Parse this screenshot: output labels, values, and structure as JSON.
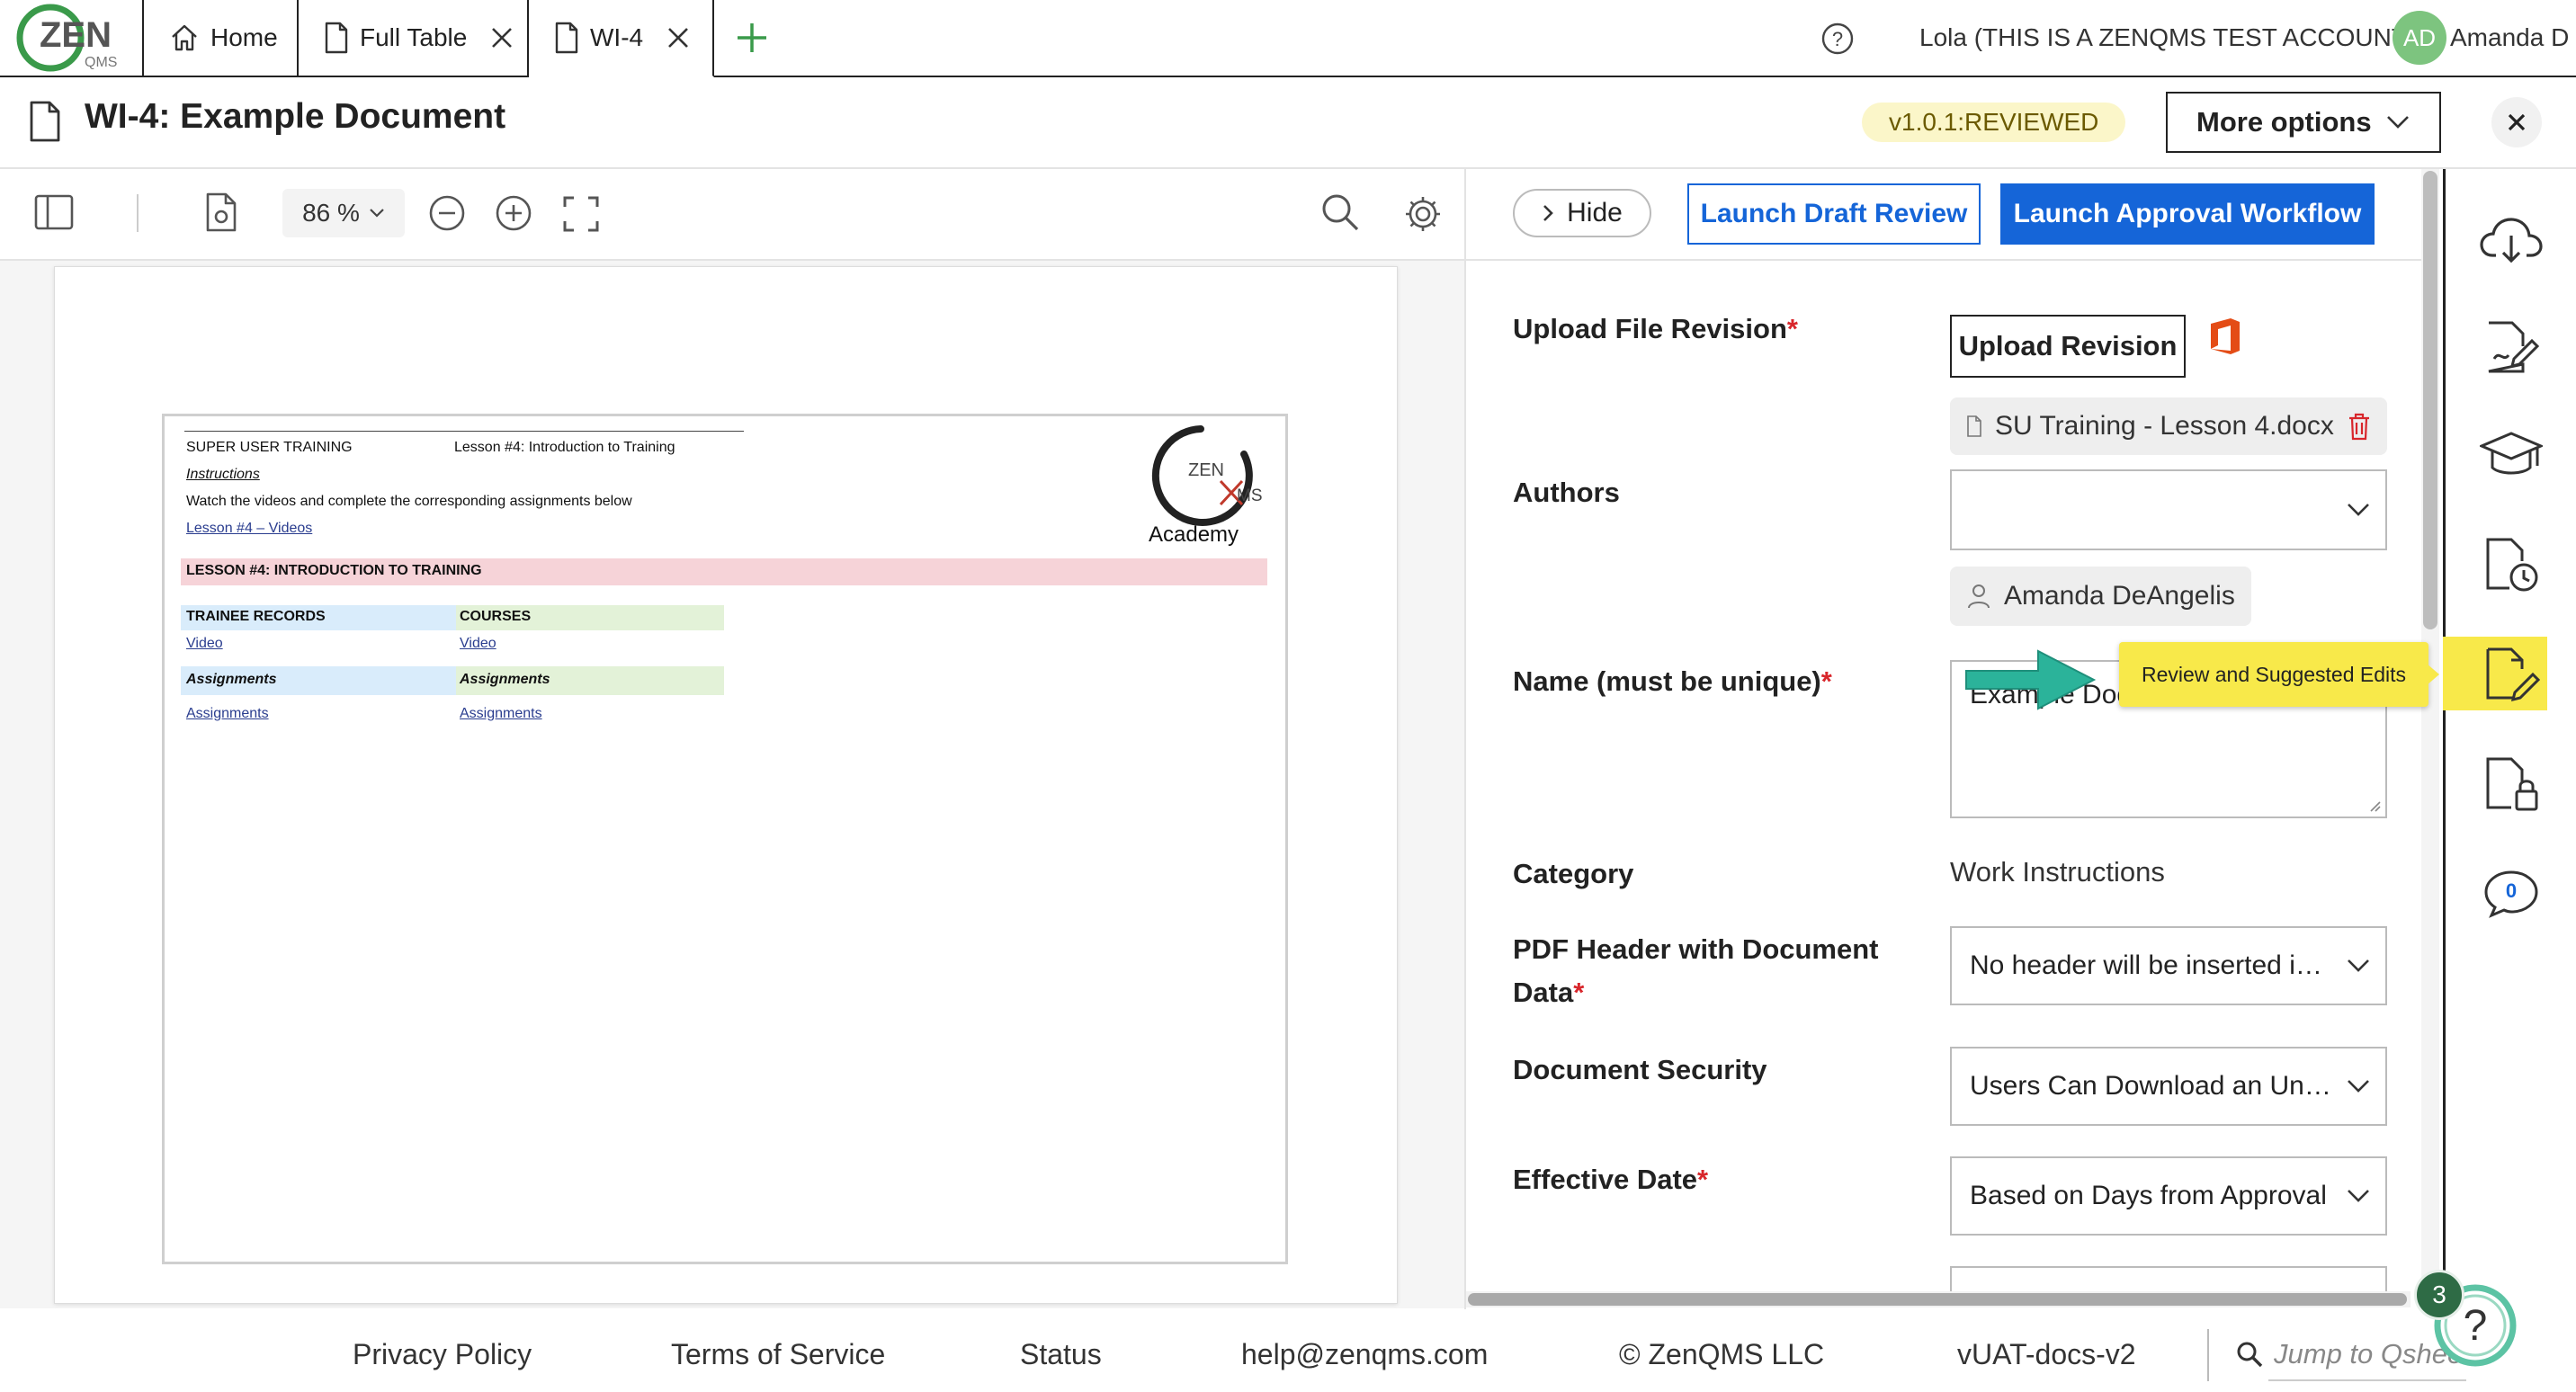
{
  "app": {
    "logo_text": "ZEN",
    "logo_sub": "QMS",
    "tabs": [
      {
        "label": "Home"
      },
      {
        "label": "Full Table"
      },
      {
        "label": "WI-4"
      }
    ],
    "account_label": "Lola (THIS IS A ZENQMS TEST ACCOUNT)",
    "user_initials": "AD",
    "user_name": "Amanda D"
  },
  "document": {
    "title": "WI-4: Example Document",
    "version": "v1.0.1:REVIEWED",
    "more_options_label": "More options"
  },
  "viewer": {
    "zoom": "86 %",
    "preview": {
      "header_left": "SUPER USER TRAINING",
      "header_mid": "Lesson #4: Introduction to Training",
      "instructions_label": "Instructions",
      "instructions_text": "Watch the videos and complete the corresponding assignments below",
      "videos_link": "Lesson #4 – Videos",
      "logo_zen": "ZEN",
      "logo_ms": "MS",
      "logo_academy": "Academy",
      "section_title": "LESSON #4: INTRODUCTION TO TRAINING",
      "col1_header": "TRAINEE RECORDS",
      "col2_header": "COURSES",
      "col1_video": "Video",
      "col2_video": "Video",
      "col1_assign_header": "Assignments",
      "col2_assign_header": "Assignments",
      "col1_assign_link": "Assignments",
      "col2_assign_link": "Assignments"
    }
  },
  "form": {
    "hide_label": "Hide",
    "draft_review_label": "Launch Draft Review",
    "approval_label": "Launch Approval Workflow",
    "upload_label": "Upload File Revision",
    "upload_button": "Upload Revision",
    "file_name": "SU Training - Lesson 4.docx",
    "authors_label": "Authors",
    "authors_value": "",
    "author_chip": "Amanda DeAngelis",
    "name_label": "Name (must be unique)",
    "name_value": "Example Document",
    "category_label": "Category",
    "category_value": "Work Instructions",
    "pdf_header_label_1": "PDF Header with Document",
    "pdf_header_label_2": "Data",
    "pdf_header_value": "No header will be inserted into PDF",
    "security_label": "Document Security",
    "security_value": "Users Can Download an Uncontrolled Copy",
    "effective_label": "Effective Date",
    "effective_value": "Based on Days from Approval",
    "required_mark": "*"
  },
  "tooltip": {
    "text": "Review and Suggested Edits"
  },
  "rail_icons": [
    "cloud-download-icon",
    "signature-icon",
    "training-cap-icon",
    "document-history-icon",
    "review-edit-icon",
    "document-lock-icon",
    "comments-icon"
  ],
  "comments_count": "0",
  "help_count": "3",
  "footer": {
    "privacy": "Privacy Policy",
    "terms": "Terms of Service",
    "status": "Status",
    "email": "help@zenqms.com",
    "copyright": "© ZenQMS LLC",
    "build": "vUAT-docs-v2",
    "jump_placeholder": "Jump to Qshee"
  },
  "colors": {
    "primary": "#1565d8",
    "highlight": "#f8e94a",
    "arrow": "#2bb39a",
    "required": "#d8262b",
    "logo_green": "#3a9a4a"
  }
}
